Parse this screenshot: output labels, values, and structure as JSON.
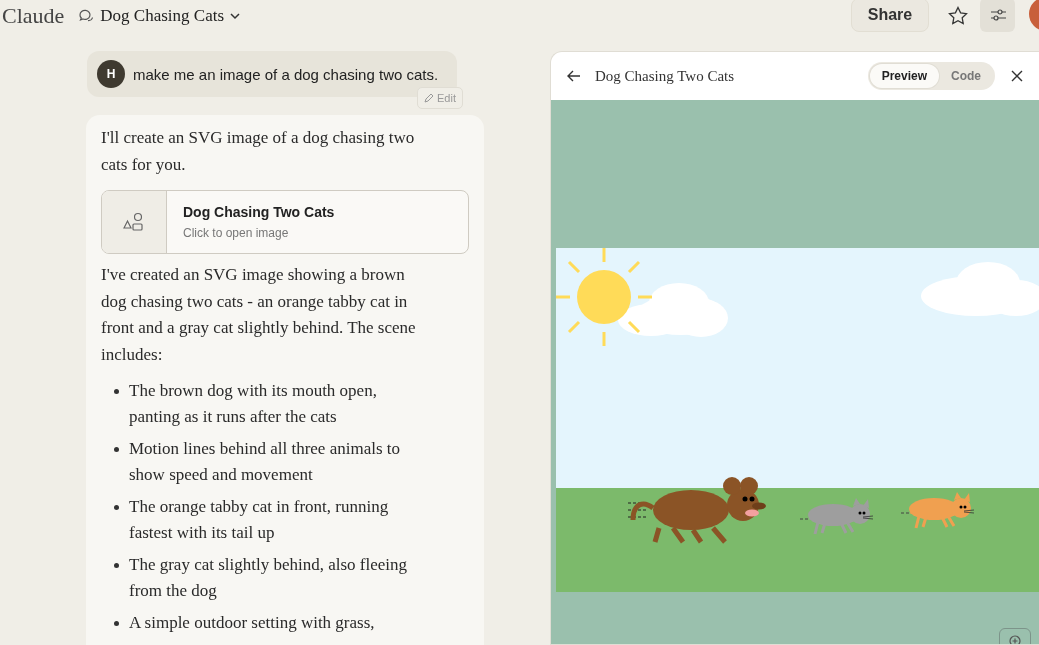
{
  "header": {
    "brand": "Claude",
    "conversation_title": "Dog Chasing Cats",
    "share_label": "Share"
  },
  "user_message": {
    "avatar_initial": "H",
    "text": "make me an image of a dog chasing two cats.",
    "edit_label": "Edit"
  },
  "assistant_message": {
    "intro": "I'll create an SVG image of a dog chasing two cats for you.",
    "artifact": {
      "title": "Dog Chasing Two Cats",
      "subtitle": "Click to open image"
    },
    "paragraph": "I've created an SVG image showing a brown dog chasing two cats - an orange tabby cat in front and a gray cat slightly behind. The scene includes:",
    "bullets": [
      "The brown dog with its mouth open, panting as it runs after the cats",
      "Motion lines behind all three animals to show speed and movement",
      "The orange tabby cat in front, running fastest with its tail up",
      "The gray cat slightly behind, also fleeing from the dog",
      "A simple outdoor setting with grass,"
    ]
  },
  "artifact_panel": {
    "title": "Dog Chasing Two Cats",
    "tabs": [
      {
        "label": "Preview",
        "selected": true
      },
      {
        "label": "Code",
        "selected": false
      }
    ]
  }
}
